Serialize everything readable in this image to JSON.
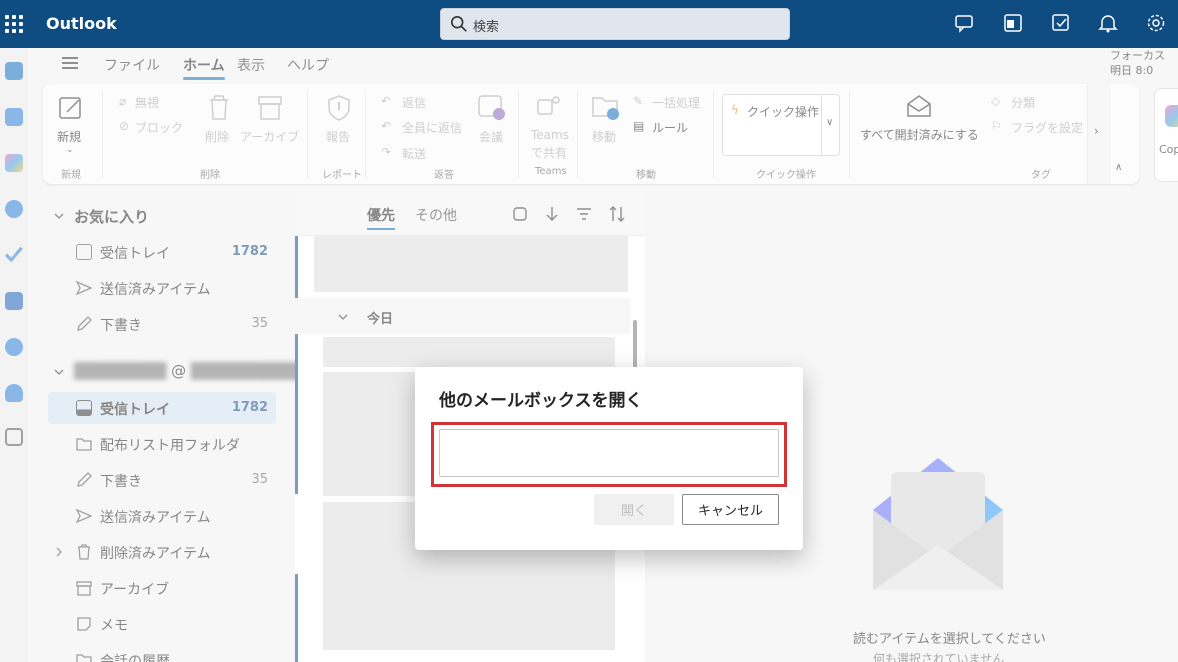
{
  "topbar": {
    "app_title": "Outlook",
    "search_placeholder": "検索"
  },
  "tabs": {
    "file": "ファイル",
    "home": "ホーム",
    "view": "表示",
    "help": "ヘルプ"
  },
  "focus": {
    "label": "フォーカス",
    "sub": "明日 8:0"
  },
  "ribbon": {
    "new": "新規",
    "ignore": "無視",
    "block": "ブロック",
    "delete": "削除",
    "archive": "アーカイブ",
    "report": "報告",
    "reply": "返信",
    "reply_all": "全員に返信",
    "forward": "転送",
    "meeting": "会議",
    "teams_line1": "Teams",
    "teams_line2": "で共有",
    "move": "移動",
    "bulk": "一括処理",
    "rules": "ルール",
    "quick_action": "クイック操作",
    "mark_all_read": "すべて開封済みにする",
    "categorize": "分類",
    "flag": "フラグを設定",
    "copilot": "Cop",
    "groups": {
      "new": "新規",
      "delete": "削除",
      "report": "レポート",
      "reply": "返答",
      "teams": "Teams",
      "move": "移動",
      "quick": "クイック操作",
      "tags": "タグ"
    }
  },
  "folders": {
    "favorites": "お気に入り",
    "fav_inbox": "受信トレイ",
    "fav_inbox_count": "1782",
    "fav_sent": "送信済みアイテム",
    "fav_drafts": "下書き",
    "fav_drafts_count": "35",
    "account": "@",
    "account_more": "...",
    "inbox": "受信トレイ",
    "inbox_count": "1782",
    "dist_list": "配布リスト用フォルダ",
    "drafts": "下書き",
    "drafts_count": "35",
    "sent": "送信済みアイテム",
    "deleted": "削除済みアイテム",
    "archive": "アーカイブ",
    "notes": "メモ",
    "history": "会話の履歴"
  },
  "message_list": {
    "tab_focused": "優先",
    "tab_other": "その他",
    "today": "今日"
  },
  "reading_pane": {
    "empty_title": "読むアイテムを選択してください",
    "empty_sub": "何も選択されていません"
  },
  "dialog": {
    "title": "他のメールボックスを開く",
    "input_value": "",
    "open_label": "開く",
    "cancel_label": "キャンセル"
  },
  "colors": {
    "topbar": "#0f4c81",
    "accent": "#0f6cbd",
    "highlight": "#d13438"
  }
}
